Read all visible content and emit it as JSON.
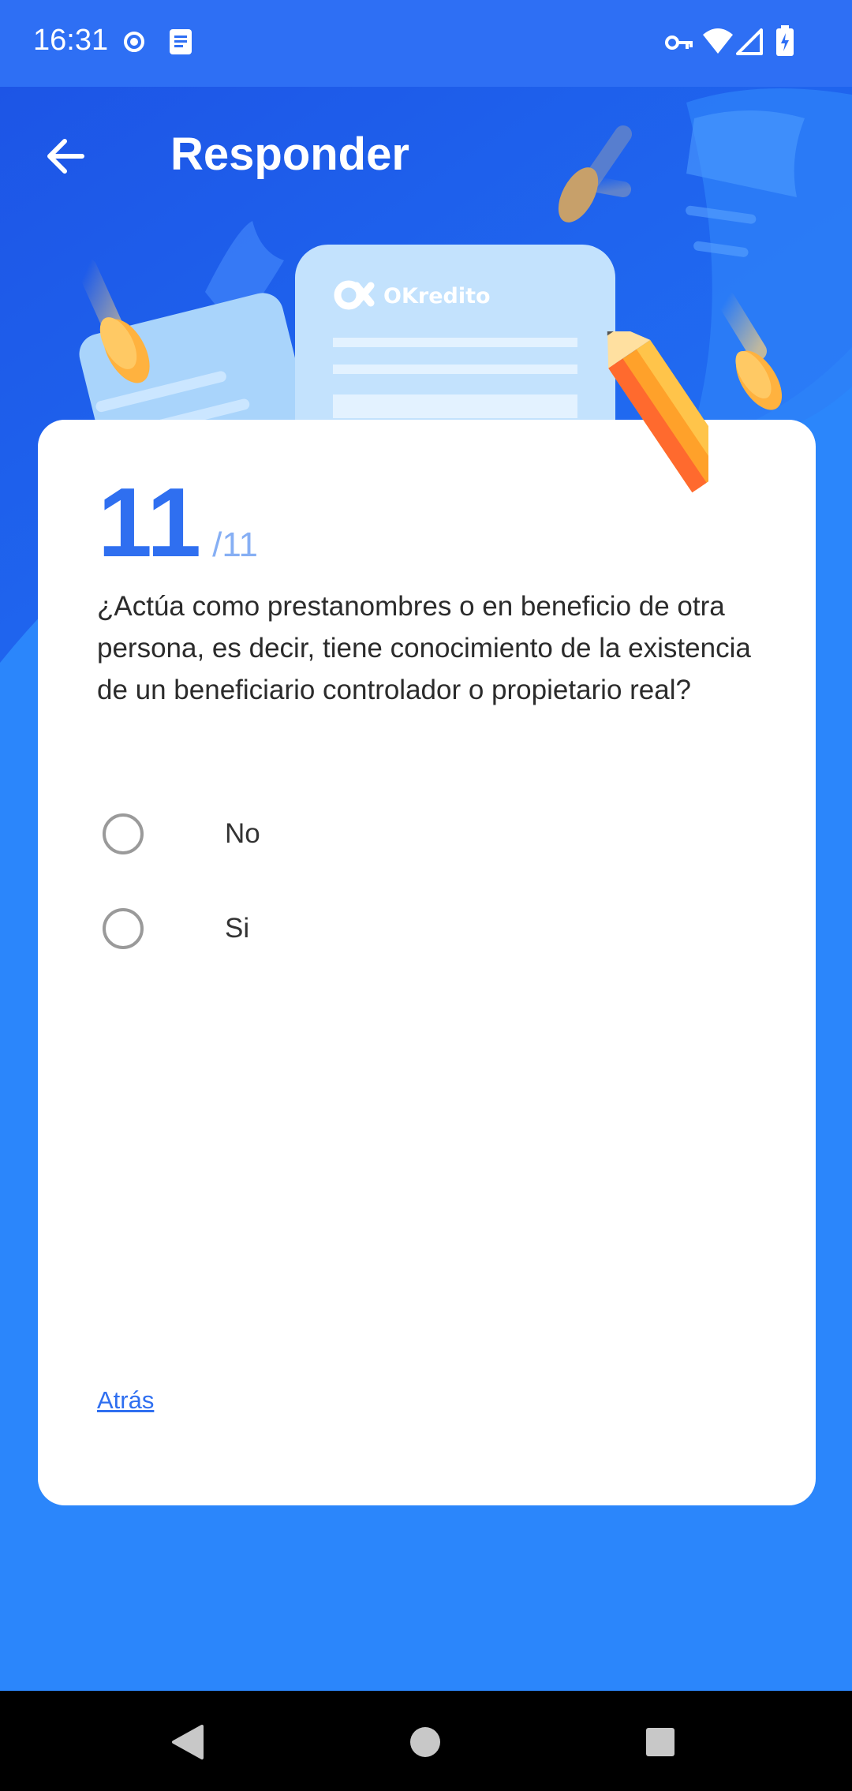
{
  "status_bar": {
    "time": "16:31",
    "icons": [
      "record-icon",
      "notes-icon",
      "vpn-key-icon",
      "wifi-icon",
      "signal-icon",
      "battery-charging-icon"
    ]
  },
  "header": {
    "title": "Responder",
    "back_icon": "arrow-left-icon"
  },
  "hero": {
    "brand": "OKredito"
  },
  "card": {
    "counter_current": "11",
    "counter_total": "/11",
    "question": "¿Actúa como prestanombres o en beneficio de otra persona, es decir, tiene conocimiento de la existencia de un beneficiario controlador o propietario real?",
    "options": [
      {
        "label": "No",
        "selected": false
      },
      {
        "label": "Si",
        "selected": false
      }
    ],
    "back_link": "Atrás"
  },
  "nav_bar": {
    "icons": [
      "nav-back-icon",
      "nav-home-icon",
      "nav-recents-icon"
    ]
  },
  "colors": {
    "primary": "#2f6ff0",
    "background": "#2b86fb",
    "status_bar": "#2e6ff4",
    "coin": "#ffb23f"
  }
}
